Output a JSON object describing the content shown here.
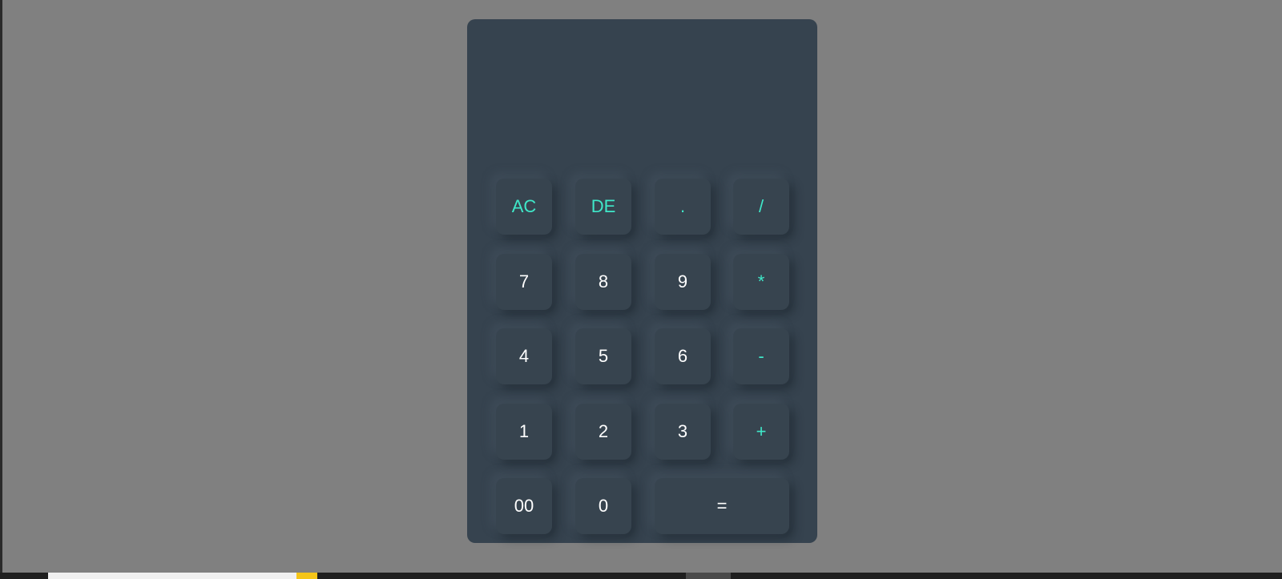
{
  "display": {
    "value": ""
  },
  "colors": {
    "background": "#808080",
    "calculator_body": "#36434f",
    "key_text": "#ffffff",
    "accent_text": "#3fe8c9"
  },
  "keys": {
    "ac": "AC",
    "de": "DE",
    "dot": ".",
    "divide": "/",
    "seven": "7",
    "eight": "8",
    "nine": "9",
    "multiply": "*",
    "four": "4",
    "five": "5",
    "six": "6",
    "minus": "-",
    "one": "1",
    "two": "2",
    "three": "3",
    "plus": "+",
    "double_zero": "00",
    "zero": "0",
    "equals": "="
  },
  "taskbar": {
    "clock": ""
  }
}
